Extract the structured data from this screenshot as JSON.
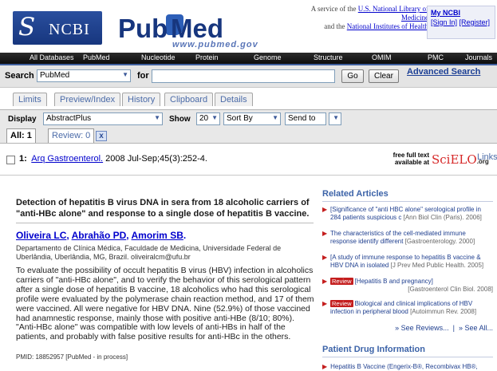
{
  "header": {
    "ncbi_glyph": "S",
    "ncbi_label": "NCBI",
    "pubmed_pub": "Pub",
    "pubmed_med": "Med",
    "pubmed_url": "www.pubmed.gov",
    "service_line1_prefix": "A service of the",
    "service_link1": "U.S. National Library of Medicine",
    "service_line2_prefix": "and the",
    "service_link2": "National Institutes of Health",
    "my_ncbi": "My NCBI",
    "sign_in": "[Sign In]",
    "register": "[Register]"
  },
  "topnav": [
    "All Databases",
    "PubMed",
    "Nucleotide",
    "Protein",
    "Genome",
    "Structure",
    "OMIM",
    "PMC",
    "Journals"
  ],
  "search": {
    "label": "Search",
    "db_value": "PubMed",
    "for_label": "for",
    "term_value": "",
    "go_label": "Go",
    "clear_label": "Clear",
    "advanced_label": "Advanced Search"
  },
  "tabs": [
    "Limits",
    "Preview/Index",
    "History",
    "Clipboard",
    "Details"
  ],
  "display": {
    "display_label": "Display",
    "format_value": "AbstractPlus",
    "show_label": "Show",
    "show_value": "20",
    "sort_value": "Sort By",
    "send_value": "Send to",
    "result_tabs": [
      "All: 1",
      "Review: 0"
    ],
    "close_glyph": "x"
  },
  "record": {
    "number": "1:",
    "journal": "Arq Gastroenterol.",
    "citation": "2008 Jul-Sep;45(3):252-4.",
    "free_text_line1": "free full text",
    "free_text_line2": "available at",
    "scielo_logo": "SciELO",
    "scielo_suffix": ".org",
    "links_label": "Links"
  },
  "abstract": {
    "title": "Detection of hepatitis B virus DNA in sera from 18 alcoholic carriers of \"anti-HBc alone\" and response to a single dose of hepatitis B vaccine.",
    "authors": [
      "Oliveira LC",
      "Abrahão PD",
      "Amorim SB"
    ],
    "affiliation": "Departamento de Clínica Médica, Faculdade de Medicina, Universidade Federal de Uberlândia, Uberlândia, MG, Brazil. oliveiralcm@ufu.br",
    "body": "To evaluate the possibility of occult hepatitis B virus (HBV) infection in alcoholics carriers of \"anti-HBc alone\", and to verify the behavior of this serological pattern after a single dose of hepatitis B vaccine, 18 alcoholics who had this serological profile were evaluated by the polymerase chain reaction method, and 17 of them were vaccined. All were negative for HBV DNA. Nine (52.9%) of those vaccined had anamnestic response, mainly those with positive anti-HBe (8/10; 80%). \"Anti-HBc alone\" was compatible with low levels of anti-HBs in half of the patients, and probably with false positive results for anti-HBc in the others.",
    "pmid": "PMID: 18852957 [PubMed - in process]"
  },
  "related": {
    "heading": "Related Articles",
    "items": [
      {
        "badge": "",
        "text": "[Significance of \"anti HBC alone\" serological profile in 284 patients suspicious c",
        "source": "[Ann Biol Clin (Paris). 2006]"
      },
      {
        "badge": "",
        "text": "The characteristics of the cell-mediated immune response identify different",
        "source": "[Gastroenterology. 2000]"
      },
      {
        "badge": "",
        "text": "[A study of immune response to hepatitis B vaccine & HBV DNA in isolated",
        "source": "[J Prev Med Public Health. 2005]"
      },
      {
        "badge": "Review",
        "text": "[Hepatitis B and pregnancy]",
        "source": "[Gastroenterol Clin Biol. 2008]"
      },
      {
        "badge": "Review",
        "text": "Biological and clinical implications of HBV infection in peripheral blood",
        "source": "[Autoimmun Rev. 2008]"
      }
    ],
    "see_reviews": "» See Reviews...",
    "see_all": "» See All..."
  },
  "drug": {
    "heading": "Patient Drug Information",
    "item": "Hepatitis B Vaccine (Engerix-B®, Recombivax HB®,"
  },
  "colors": {
    "brand_blue": "#17367e",
    "link_blue": "#00c",
    "review_red": "#c41e1e",
    "nav_black": "#111111"
  }
}
